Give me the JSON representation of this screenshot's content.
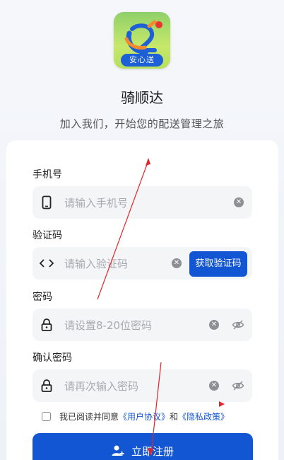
{
  "app": {
    "logo_badge": "安心送",
    "name": "骑顺达",
    "subtitle": "加入我们，开始您的配送管理之旅"
  },
  "form": {
    "phone": {
      "label": "手机号",
      "placeholder": "请输入手机号",
      "icon": "phone-icon"
    },
    "code": {
      "label": "验证码",
      "placeholder": "请输入验证码",
      "icon": "code-icon",
      "button": "获取验证码"
    },
    "password": {
      "label": "密码",
      "placeholder": "请设置8-20位密码",
      "icon": "lock-icon"
    },
    "confirm": {
      "label": "确认密码",
      "placeholder": "请再次输入密码",
      "icon": "lock-icon"
    },
    "agreement": {
      "prefix": "我已阅读并同意",
      "user_agreement": "《用户协议》",
      "and": "和",
      "privacy_policy": "《隐私政策》",
      "checked": false
    },
    "submit": "立即注册"
  },
  "colors": {
    "primary": "#1256d3",
    "field_bg": "#f4f5f7",
    "annotation_arrow": "#e0262b"
  }
}
